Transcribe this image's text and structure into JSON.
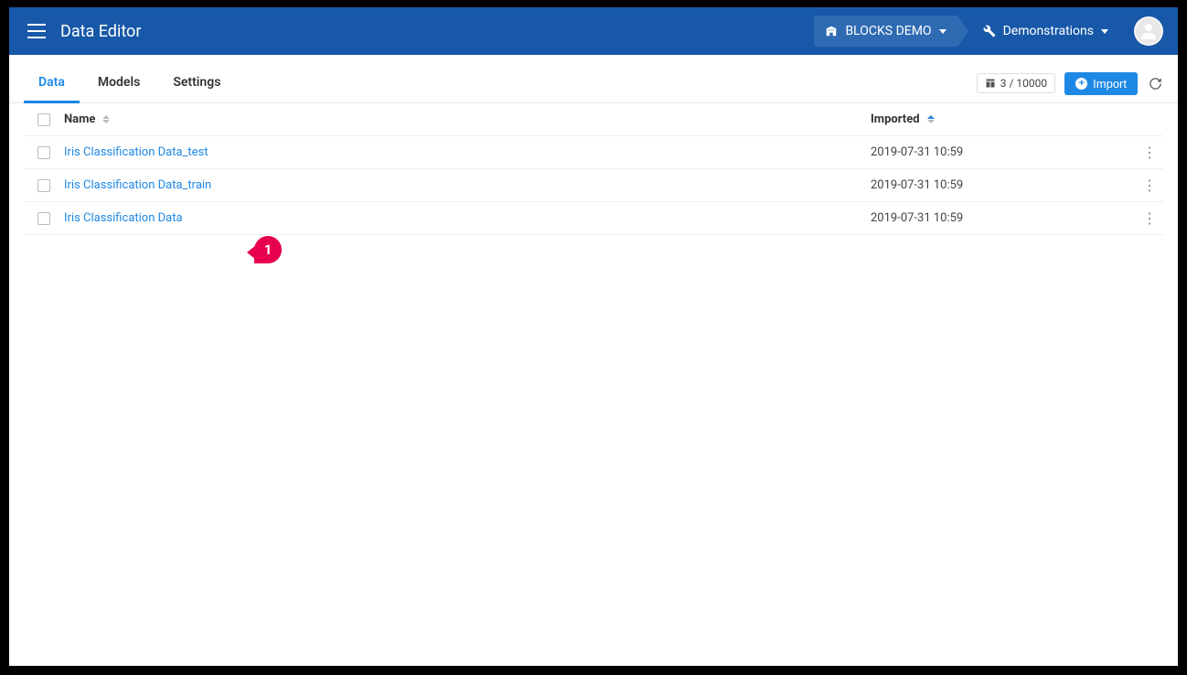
{
  "header": {
    "title": "Data Editor",
    "breadcrumb": {
      "org": "BLOCKS DEMO",
      "project": "Demonstrations"
    }
  },
  "tabs": {
    "data": "Data",
    "models": "Models",
    "settings": "Settings",
    "active": "data"
  },
  "toolbar": {
    "counter": "3 / 10000",
    "import_label": "Import"
  },
  "table": {
    "columns": {
      "name": "Name",
      "imported": "Imported"
    },
    "rows": [
      {
        "name": "Iris Classification Data_test",
        "imported": "2019-07-31 10:59"
      },
      {
        "name": "Iris Classification Data_train",
        "imported": "2019-07-31 10:59"
      },
      {
        "name": "Iris Classification Data",
        "imported": "2019-07-31 10:59"
      }
    ]
  },
  "callout": {
    "label": "1"
  }
}
